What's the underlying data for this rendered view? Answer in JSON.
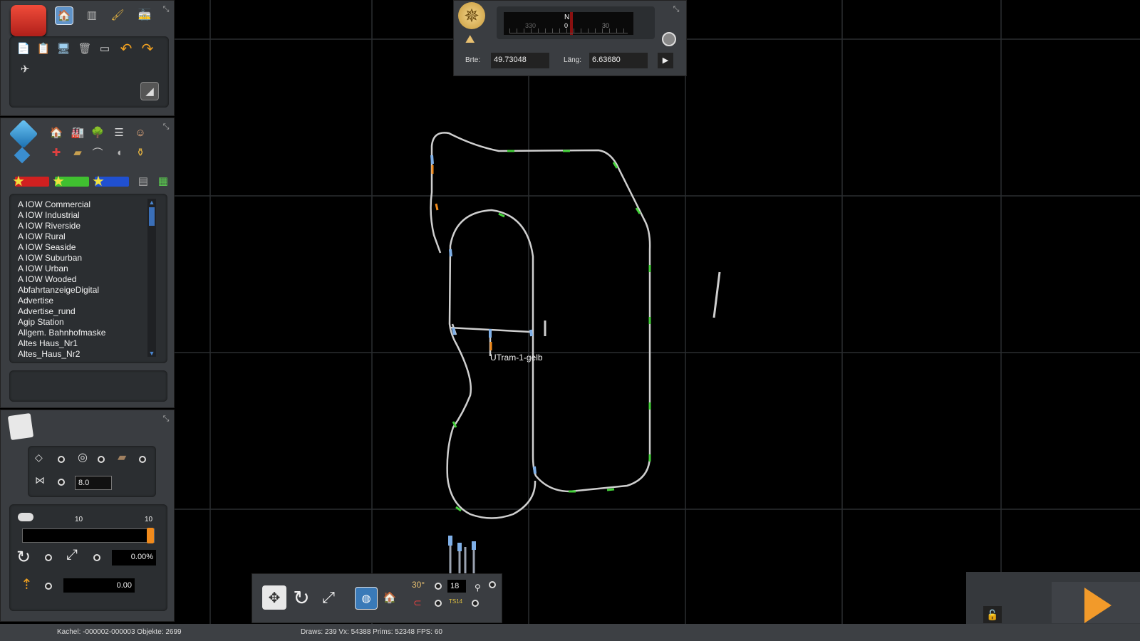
{
  "left_panel": {
    "list_items": [
      "A IOW Commercial",
      "A IOW Industrial",
      "A IOW Riverside",
      "A IOW Rural",
      "A IOW Seaside",
      "A IOW Suburban",
      "A IOW Urban",
      "A IOW Wooded",
      "AbfahrtanzeigeDigital",
      "Advertise",
      "Advertise_rund",
      "Agip Station",
      "Allgem. Bahnhofmaske",
      "Altes Haus_Nr1",
      "Altes_Haus_Nr2"
    ],
    "grid_value": "8.0",
    "slider_min_label": "10",
    "slider_max_label": "10",
    "slider_value": 1.0,
    "rotation_value": "0.00%",
    "height_value": "0.00"
  },
  "compass": {
    "north_label": "N",
    "ticks": [
      "330",
      "0",
      "30"
    ],
    "lat_label": "Brte:",
    "lat_value": "49.73048",
    "lon_label": "Läng:",
    "lon_value": "6.63680"
  },
  "map": {
    "vehicle_label": "UTram-1-gelb"
  },
  "bottom_toolbar": {
    "count_value": "18",
    "ts_label": "TS14"
  },
  "status": {
    "tile_info": "Kachel: -000002-000003  Objekte: 2699",
    "render_stats": "Draws: 239 Vx: 54388 Prims: 52348 FPS: 60"
  },
  "colors": {
    "panel_bg": "#3a3d41",
    "inset_bg": "#2b2e31",
    "track": "#c8c8c8",
    "accent_orange": "#f08a1c",
    "grid_line": "#2a2d30"
  }
}
